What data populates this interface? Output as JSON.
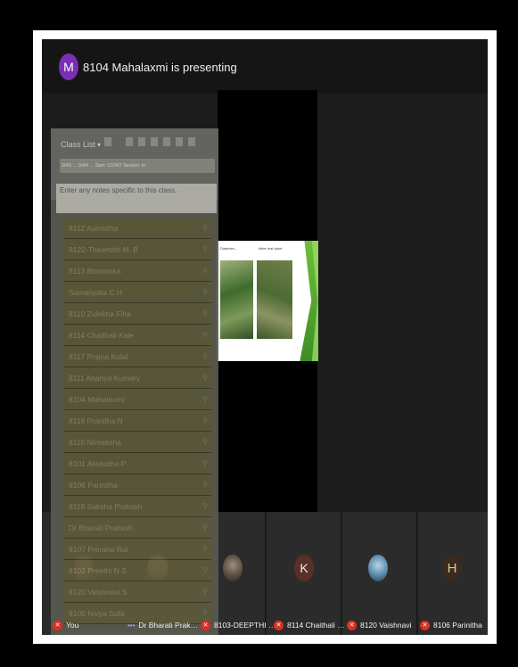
{
  "header": {
    "avatar_letter": "M",
    "presenting_text": "8104 Mahalaxmi is presenting"
  },
  "class_list": {
    "title": "Class List",
    "toolbar_text": "3/4/5 …  3/4/4 …  Start: 12/24/7 Session: In",
    "notes_placeholder": "Enter any notes specific to this class.",
    "students": [
      "8112 Ashmitha",
      "8122-Theertoth M. B",
      "8113 Bhoomika",
      "Samanyata C H",
      "8110 Zulekha Fiha",
      "8114 Chaithali Kale",
      "8117 Prajna Kulal",
      "8111 Ananya Kumary",
      "8104 Mahalaxmi",
      "8118 Pranitha N",
      "8116 Nireeksha",
      "8101 Akshatha P",
      "8106 Parinitha",
      "8119 Saksha Prakash",
      "Dr Bharati Prakash",
      "8107 Prerana Rai",
      "8102 Preethi N S",
      "8120 Vaishnavi S",
      "8105 Nivya Safa"
    ]
  },
  "slide": {
    "caption_left": "Diabetes...",
    "caption_right": "bitter leaf plant"
  },
  "participants": [
    {
      "name": "You",
      "muted": true
    },
    {
      "name": "Dr Bharati Prak…",
      "muted": false
    },
    {
      "name": "8103-DEEPTHI …",
      "muted": true
    },
    {
      "name": "8114 Chaithali …",
      "muted": true,
      "avatar_letter": "K"
    },
    {
      "name": "8120 Vaishnavi",
      "muted": true
    },
    {
      "name": "8106 Parinitha",
      "muted": true,
      "avatar_letter": "H"
    }
  ],
  "colors": {
    "presenter_avatar": "#7b2fb2",
    "mic_off": "#d93025",
    "slide_accent": "#6fbf3a"
  }
}
